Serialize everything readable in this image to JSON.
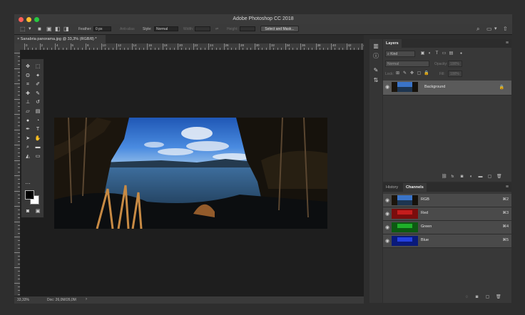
{
  "app": {
    "title": "Adobe Photoshop CC 2018"
  },
  "options_bar": {
    "feather_label": "Feather:",
    "feather_value": "0 px",
    "antialias_label": "Anti-alias",
    "style_label": "Style:",
    "style_value": "Normal",
    "width_label": "Width:",
    "height_label": "Height:",
    "select_mask_label": "Select and Mask..."
  },
  "document": {
    "tab_label": "Sanabria panorama.jpg @ 33,3% (RGB/8) *"
  },
  "ruler": {
    "h_labels": [
      "0",
      "2",
      "4",
      "6",
      "8",
      "10",
      "12",
      "14",
      "16",
      "18",
      "20",
      "22",
      "24",
      "26",
      "28",
      "30",
      "32",
      "34",
      "36",
      "38",
      "40",
      "42",
      "44"
    ]
  },
  "status": {
    "zoom": "33,33%",
    "doc_info": "Doc: 26,0M/26,0M"
  },
  "layers_panel": {
    "tab": "Layers",
    "filter_kind": "Kind",
    "blend_mode": "Normal",
    "opacity_label": "Opacity:",
    "opacity_value": "100%",
    "lock_label": "Lock:",
    "fill_label": "Fill:",
    "fill_value": "100%",
    "layers": [
      {
        "name": "Background"
      }
    ]
  },
  "channels_panel": {
    "tabs": [
      "History",
      "Channels"
    ],
    "active_tab": "Channels",
    "channels": [
      {
        "name": "RGB",
        "shortcut": "⌘2"
      },
      {
        "name": "Red",
        "shortcut": "⌘3"
      },
      {
        "name": "Green",
        "shortcut": "⌘4"
      },
      {
        "name": "Blue",
        "shortcut": "⌘5"
      }
    ]
  },
  "colors": {
    "accent": "#2f7fd8",
    "traffic_red": "#fe5f57",
    "traffic_yellow": "#febc2e",
    "traffic_green": "#28c840"
  }
}
